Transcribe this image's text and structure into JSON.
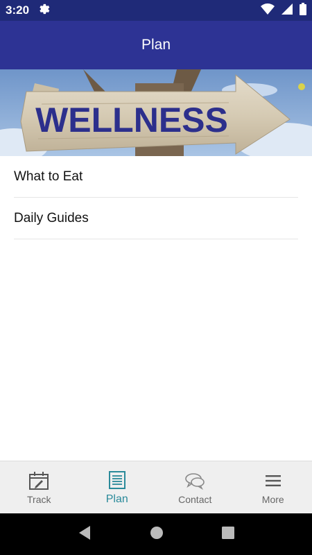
{
  "status_bar": {
    "time": "3:20"
  },
  "app_bar": {
    "title": "Plan"
  },
  "banner": {
    "sign_text": "WELLNESS"
  },
  "list": {
    "items": [
      {
        "label": "What to Eat"
      },
      {
        "label": "Daily Guides"
      }
    ]
  },
  "bottom_nav": {
    "items": [
      {
        "label": "Track",
        "icon": "calendar-edit-icon"
      },
      {
        "label": "Plan",
        "icon": "list-icon",
        "active": true
      },
      {
        "label": "Contact",
        "icon": "chat-bubbles-icon"
      },
      {
        "label": "More",
        "icon": "menu-icon"
      }
    ]
  },
  "colors": {
    "status_bar": "#1f2a78",
    "app_bar": "#2d3394",
    "active_tab": "#2a8a9a",
    "inactive_tab": "#666666"
  }
}
